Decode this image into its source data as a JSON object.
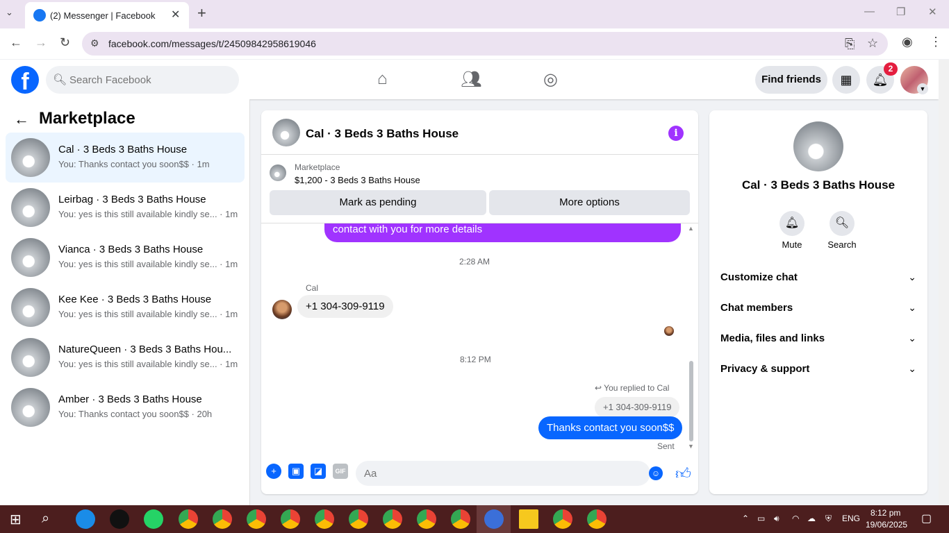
{
  "browser": {
    "tab_title": "(2) Messenger | Facebook",
    "url": "facebook.com/messages/t/24509842958619046"
  },
  "fb_header": {
    "search_placeholder": "Search Facebook",
    "find_friends": "Find friends",
    "notification_count": "2"
  },
  "sidebar": {
    "title": "Marketplace",
    "conversations": [
      {
        "name": "Cal · 3 Beds 3 Baths House",
        "snippet": "You: Thanks contact you soon$$ · 1m",
        "active": true
      },
      {
        "name": "Leirbag · 3 Beds 3 Baths House",
        "snippet": "You: yes is this still available kindly se... · 1m"
      },
      {
        "name": "Vianca · 3 Beds 3 Baths House",
        "snippet": "You: yes is this still available kindly se... · 1m"
      },
      {
        "name": "Kee Kee · 3 Beds 3 Baths House",
        "snippet": "You: yes is this still available kindly se... · 1m"
      },
      {
        "name": "NatureQueen · 3 Beds 3 Baths Hou...",
        "snippet": "You: yes is this still available kindly se... · 1m"
      },
      {
        "name": "Amber · 3 Beds 3 Baths House",
        "snippet": "You: Thanks contact you soon$$ · 20h"
      }
    ]
  },
  "chat": {
    "title": "Cal · 3 Beds 3 Baths House",
    "marketplace_label": "Marketplace",
    "listing": "$1,200 - 3 Beds 3 Baths House",
    "mark_pending": "Mark as pending",
    "more_options": "More options",
    "messages": {
      "partial_out": "contact with you for more details",
      "time1": "2:28 AM",
      "sender": "Cal",
      "phone": "+1 304-309-9119",
      "time2": "8:12 PM",
      "replied_to": "You replied to Cal",
      "quoted": "+1 304-309-9119",
      "reply": "Thanks contact you soon$$",
      "status": "Sent"
    },
    "composer_placeholder": "Aa"
  },
  "details": {
    "name": "Cal · 3 Beds 3 Baths House",
    "mute": "Mute",
    "search": "Search",
    "sections": [
      "Customize chat",
      "Chat members",
      "Media, files and links",
      "Privacy & support"
    ]
  },
  "taskbar": {
    "lang": "ENG",
    "time": "8:12 pm",
    "date": "19/06/2025"
  },
  "colors": {
    "accent": "#0866ff",
    "purple": "#a033ff",
    "taskbar": "#4c1e1e"
  }
}
